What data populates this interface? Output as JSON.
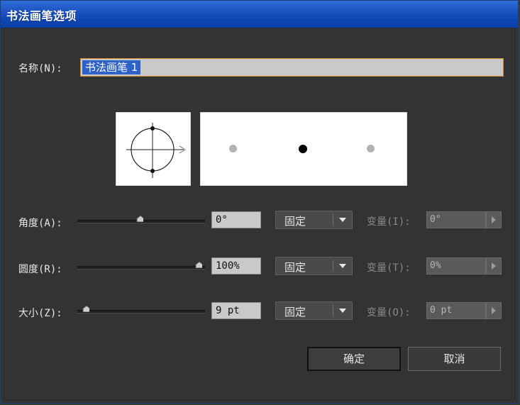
{
  "window": {
    "title": "书法画笔选项"
  },
  "name_field": {
    "label": "名称(N):",
    "value": "书法画笔 1"
  },
  "rows": [
    {
      "label": "角度(A):",
      "value": "0°",
      "mode": "固定",
      "variation_label": "变量(I):",
      "variation_value": "0°"
    },
    {
      "label": "圆度(R):",
      "value": "100%",
      "mode": "固定",
      "variation_label": "变量(T):",
      "variation_value": "0%"
    },
    {
      "label": "大小(Z):",
      "value": "9 pt",
      "mode": "固定",
      "variation_label": "变量(O):",
      "variation_value": "0 pt"
    }
  ],
  "buttons": {
    "ok": "确定",
    "cancel": "取消"
  },
  "colors": {
    "title_bar": "#1f56c4",
    "dialog_bg": "#333333",
    "selection": "#2f62c8",
    "focus_border": "#d38a2c"
  },
  "icons": {
    "preview_arrow": "arrow-right-icon",
    "dropdown": "chevron-down-icon",
    "variation": "triangle-right-icon"
  }
}
